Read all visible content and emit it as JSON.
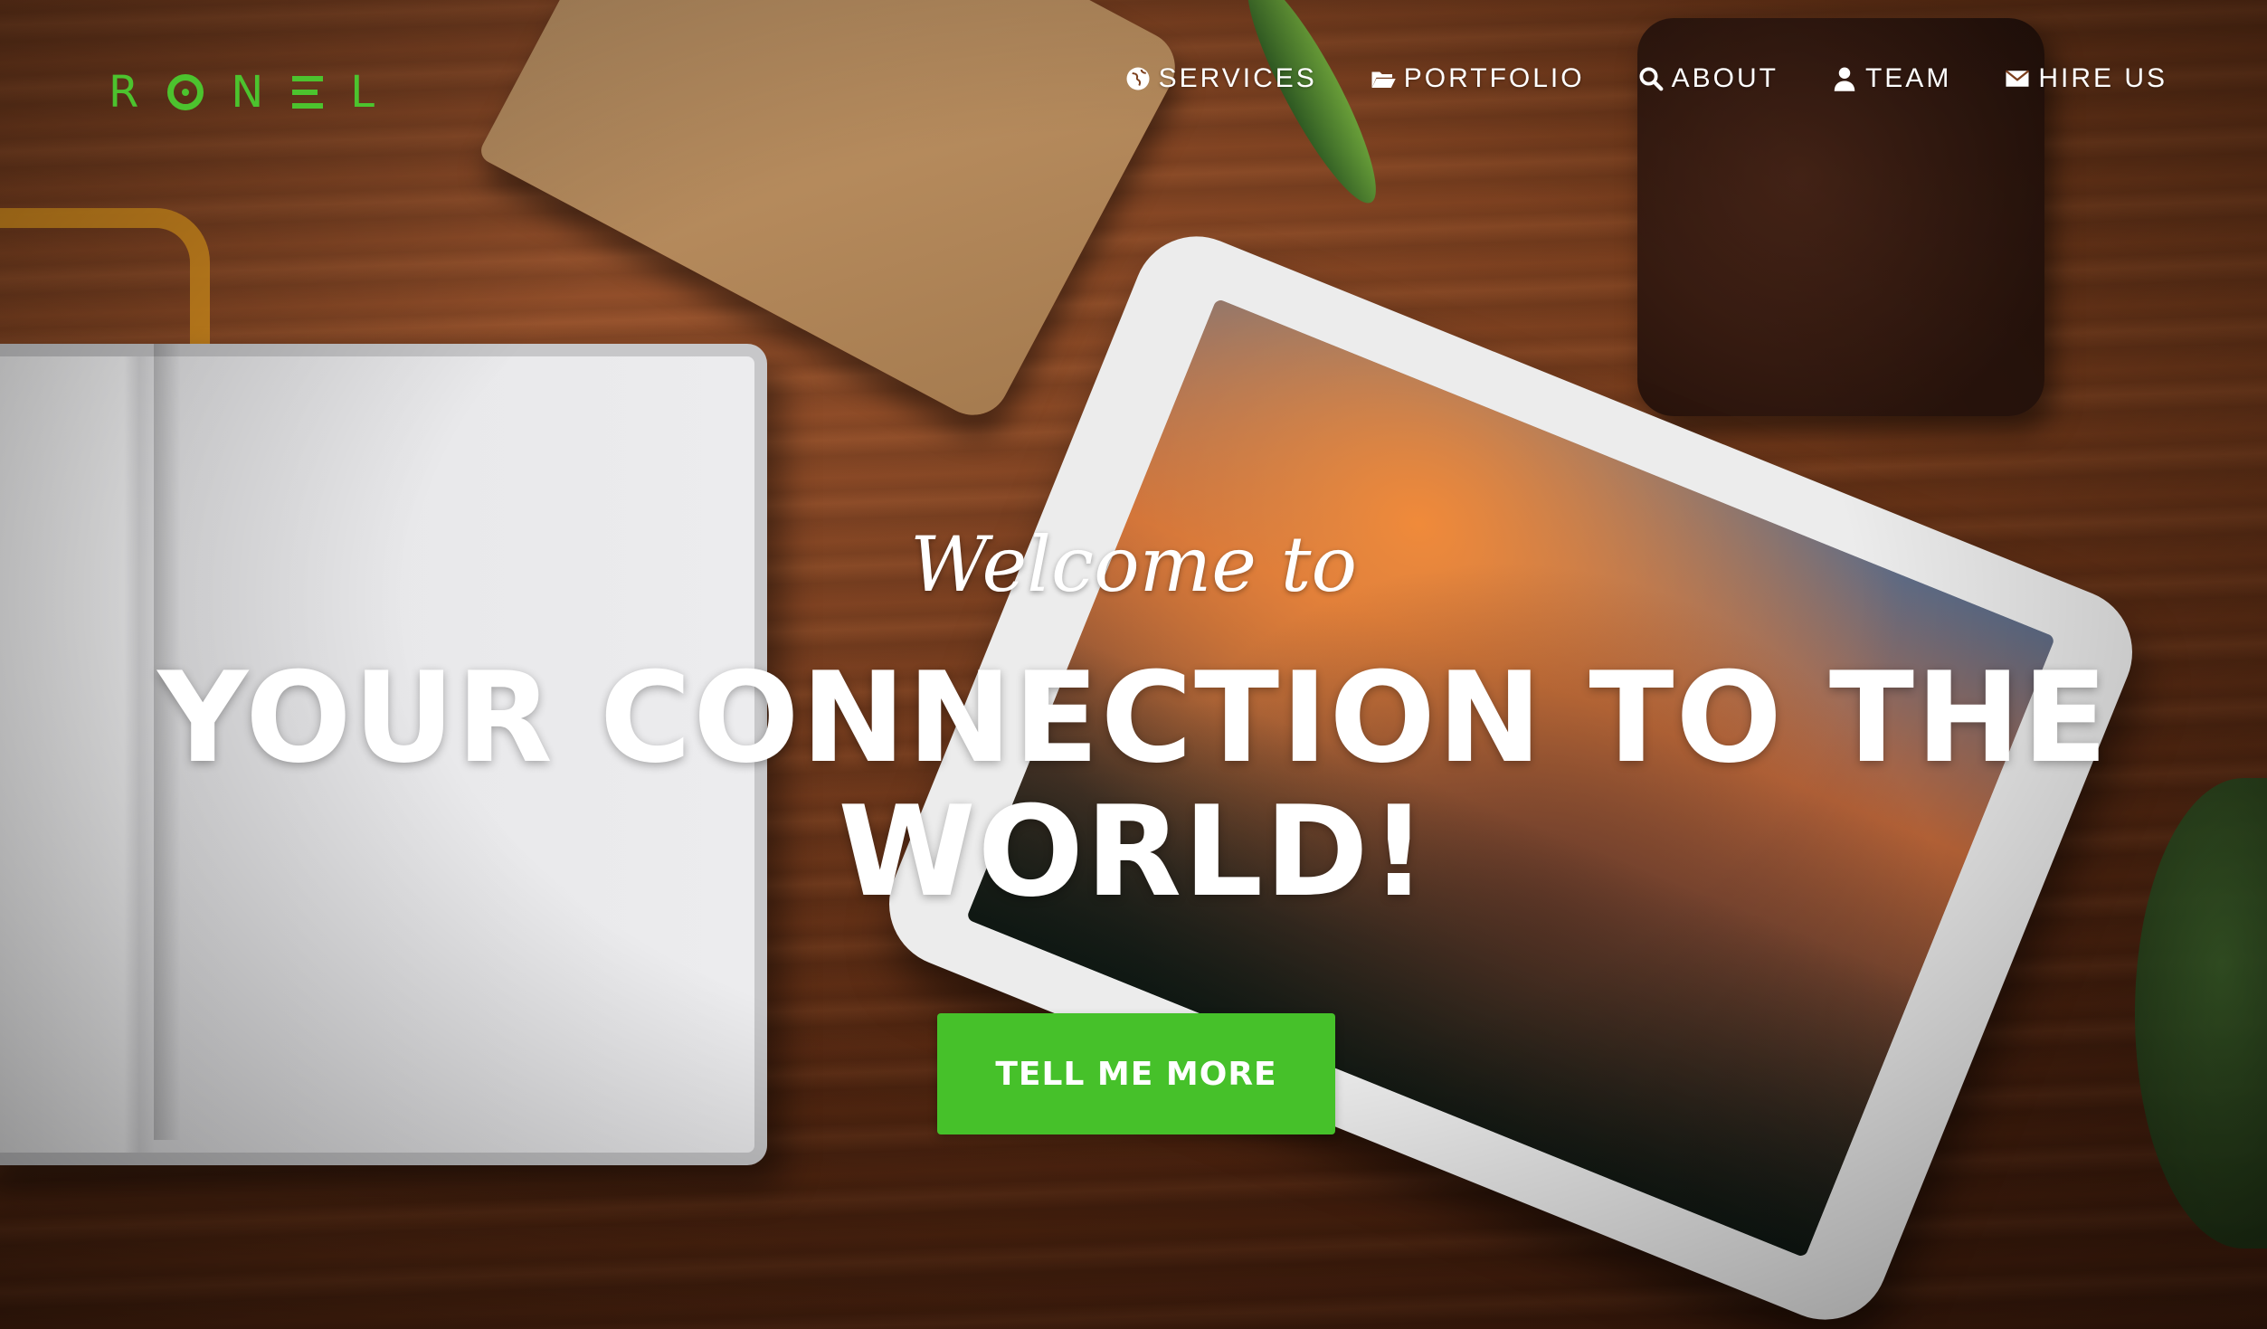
{
  "brand": {
    "logo_letters": [
      "R",
      "N",
      "L"
    ],
    "accent_color": "#4cc32e"
  },
  "nav": {
    "items": [
      {
        "label": "SERVICES",
        "icon": "globe-icon"
      },
      {
        "label": "PORTFOLIO",
        "icon": "folder-open-icon"
      },
      {
        "label": "ABOUT",
        "icon": "search-icon"
      },
      {
        "label": "TEAM",
        "icon": "user-icon"
      },
      {
        "label": "HIRE US",
        "icon": "envelope-icon"
      }
    ]
  },
  "hero": {
    "welcome": "Welcome to",
    "headline": "YOUR CONNECTION TO THE WORLD!",
    "cta_label": "TELL ME MORE",
    "cta_color": "#46c12a"
  }
}
